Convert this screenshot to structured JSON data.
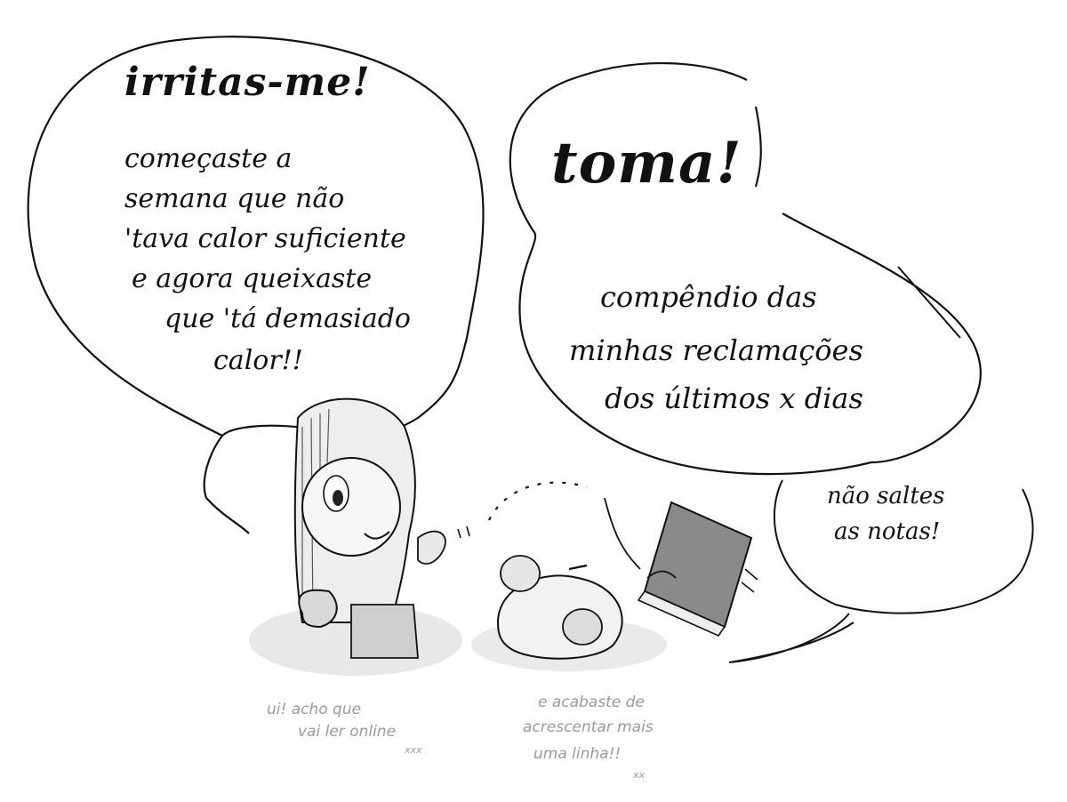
{
  "bubble_left": {
    "title": "irritas-me!",
    "lines": [
      "começaste a",
      "semana que não",
      "'tava calor suficiente",
      "e agora queixaste",
      "que 'tá demasiado",
      "calor!!"
    ]
  },
  "bubble_right": {
    "title": "toma!",
    "lines": [
      "compêndio das",
      "minhas reclamações",
      "dos últimos x dias"
    ]
  },
  "bubble_small": {
    "lines": [
      "não saltes",
      "as notas!"
    ]
  },
  "captions": {
    "left": [
      "ui! acho que",
      "vai ler online",
      "xxx"
    ],
    "right": [
      "e acabaste de",
      "acrescentar mais",
      "uma linha!!",
      "xx"
    ]
  }
}
